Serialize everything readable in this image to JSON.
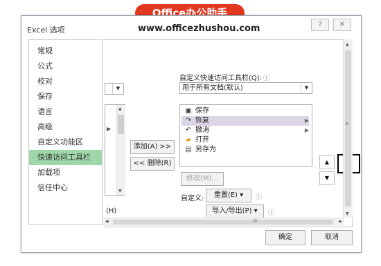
{
  "banner": {
    "text": "Office办公助手"
  },
  "window": {
    "title": "Excel 选项",
    "watermark_url": "www.officezhushou.com",
    "help_btn": "?",
    "close_btn": "✕"
  },
  "sidebar": {
    "items": [
      {
        "label": "常规"
      },
      {
        "label": "公式"
      },
      {
        "label": "校对"
      },
      {
        "label": "保存"
      },
      {
        "label": "语言"
      },
      {
        "label": "高级"
      },
      {
        "label": "自定义功能区"
      },
      {
        "label": "快速访问工具栏",
        "active": true
      },
      {
        "label": "加载项"
      },
      {
        "label": "信任中心"
      }
    ]
  },
  "main": {
    "customize_qat_label": "自定义快速访问工具栏(Q):",
    "qat_scope_value": "用于所有文档(默认)",
    "left_combo_value": "",
    "qat_items": [
      {
        "icon": "save-icon",
        "glyph": "▣",
        "label": "保存"
      },
      {
        "icon": "redo-icon",
        "glyph": "↷",
        "label": "恢复",
        "selected": true,
        "has_submenu": true
      },
      {
        "icon": "undo-icon",
        "glyph": "↶",
        "label": "撤消",
        "has_submenu": true
      },
      {
        "icon": "open-folder-icon",
        "glyph": "▰",
        "label": "打开"
      },
      {
        "icon": "save-as-icon",
        "glyph": "▤",
        "label": "另存为"
      }
    ],
    "add_button": "添加(A) >>",
    "remove_button": "<< 删除(R)",
    "modify_button": "修改(M)...",
    "customize_label": "自定义:",
    "reset_button": "重置(E) ▾",
    "import_export_button": "导入/导出(P) ▾",
    "partial_h": "(H)",
    "info_glyph": "ⓘ",
    "move_up_glyph": "▲",
    "move_down_glyph": "▼",
    "scroll_h_mark": "III",
    "scroll_v_mark": "≡"
  },
  "footer": {
    "ok_button": "确定",
    "cancel_button": "取消"
  },
  "colors": {
    "banner": "#e2381f",
    "active_nav": "#9fd7a8",
    "selected_item": "#dcd5e6"
  }
}
